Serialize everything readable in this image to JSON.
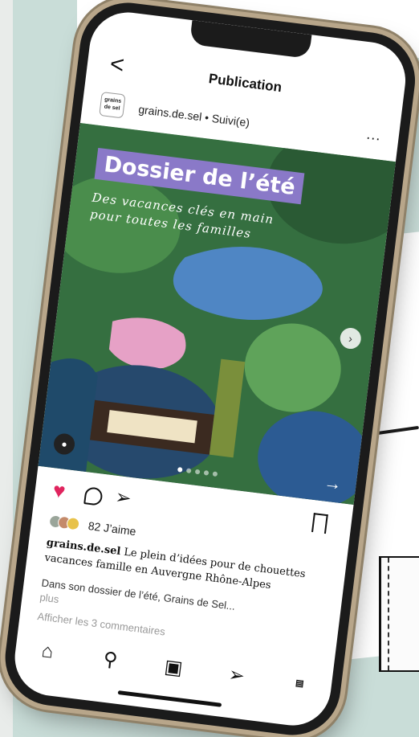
{
  "header": {
    "back_glyph": "<",
    "title": "Publication"
  },
  "post": {
    "avatar_text": "grains de sel",
    "username_line": "grains.de.sel • Suivi(e)",
    "more_glyph": "...",
    "image": {
      "headline": "Dossier de l’été",
      "subline": "Des vacances clés en main pour toutes les familles",
      "carousel_dots": 5,
      "active_dot": 0
    },
    "likes": "82 J’aime",
    "caption_user": "grains.de.sel",
    "caption_text": "Le plein d’idées pour de chouettes vacances famille en Auvergne Rhône-Alpes",
    "description": "Dans son dossier de l’été, Grains de Sel...",
    "more_label": "plus",
    "comments_label": "Afficher les 3 commentaires"
  },
  "icons": {
    "like": "heart-icon",
    "comment": "comment-icon",
    "share": "send-icon",
    "save": "bookmark-icon",
    "nav": [
      "home-icon",
      "search-icon",
      "reels-icon",
      "send-icon",
      "profile-icon"
    ]
  },
  "colors": {
    "like": "#e0245e",
    "headline_bg": "#8a79c8",
    "image_green": "#3f8a4a",
    "background_mint": "#c9ddd8"
  }
}
